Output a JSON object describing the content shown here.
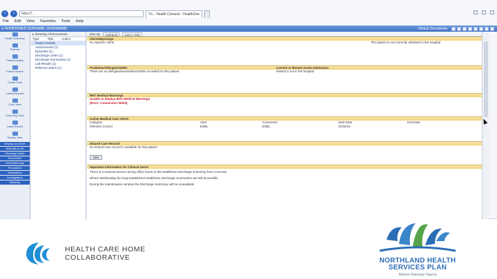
{
  "browser": {
    "url": "https://...",
    "tab1": "Tri... Health Connect - HealthOne",
    "tab2": "",
    "menu": [
      "File",
      "Edit",
      "View",
      "Favorites",
      "Tools",
      "Help"
    ]
  },
  "app": {
    "breadcrumb": "▸ SHORTENED SURNAME, GIVENNAME",
    "clinical_documents": "Clinical Documents"
  },
  "left_rail": {
    "items": [
      "Health Summary",
      "Referral",
      "Patient Details",
      "Patient Search",
      "Create Form",
      "Letters/Reports",
      "Clinic View",
      "Clinic Day View",
      "Order Results",
      "Results View"
    ],
    "blue_items": [
      "Whanau and NOK",
      "Referrals to NK",
      "Discharge Dates",
      "Encounters",
      "Alerts/Warnings",
      "Procedures",
      "Medications",
      "Investigations",
      "Maternity"
    ]
  },
  "tree": {
    "search": "▸ Showing All Documents",
    "col_type": "Type",
    "col_title": "Title",
    "col_author": "Author",
    "rows": [
      "Patient Details",
      "Assessments (1)",
      "Episodes (1)",
      "Discharge Letter (1)",
      "Discharge Summaries (1)",
      "Lab Results (1)",
      "Referral Letters (1)"
    ]
  },
  "content": {
    "filter_label": "View By",
    "filter_value": "Category",
    "filter_last": "Last 1 Year",
    "sec1_title": "Alerts/Warnings",
    "sec1_text": "No Specific Alerts",
    "sec1_right": "The patient is not currently admitted to the hospital",
    "sec2_title": "Problems/Allergies/ADRs",
    "sec2_text": "There are no allergies/sensitivities/ADRs recorded for this patient",
    "sec2_right_title": "Current or Recent Acute Admission",
    "sec2_right_text": "Patient is not in the hospital",
    "sec3_title": "BHT Medical Warnings",
    "sec3_red1": "Unable to display BHT Medical Warnings",
    "sec3_red2": "(Error: Connection failed)",
    "sec4_title": "Active Medical Care Alerts",
    "grid_cols": [
      "Category",
      "Alert",
      "Comments",
      "Start Date",
      "End Date"
    ],
    "grid_row": [
      "Infection Control",
      "ESBL",
      "ESBL",
      "01/02/19",
      ""
    ],
    "sec5_title": "Shared Care Record",
    "sec5_text": "No shared care record is available for this patient",
    "sec5_btn": "View",
    "sec6_title": "Important Information for Clinical Users",
    "sec6_l1": "There is a reduced service during office hours to the HealthOne Discharge Summary from Concerto",
    "sec6_l2": "Where Wednesday the long-established HealthOne Discharge Summaries are still accessible",
    "sec6_l3": "During the maintenance window the Discharge Summary will be unavailable"
  },
  "logos": {
    "hchc_line1": "HEALTH CARE HOME",
    "hchc_line2": "COLLABORATIVE",
    "nhsp_line1": "NORTHLAND HEALTH",
    "nhsp_line2": "SERVICES PLAN",
    "nhsp_sub": "Mahere Ratonga Hauora",
    "hchc_color": "#1e8fd6",
    "nhsp_color": "#2a6db5"
  }
}
